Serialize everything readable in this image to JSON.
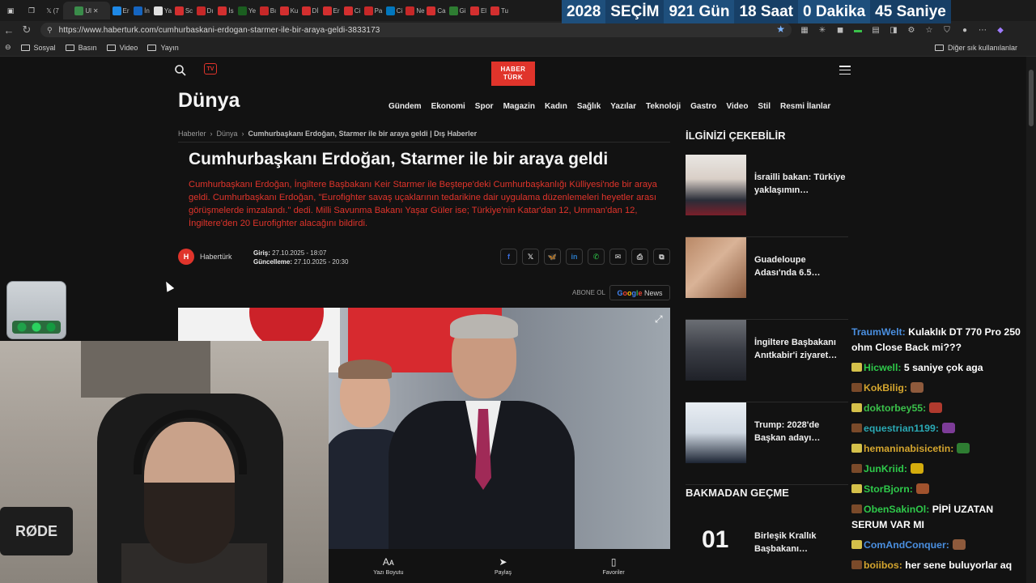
{
  "countdown": {
    "year": "2028",
    "title": "SEÇİM",
    "days": "921",
    "days_unit": "Gün",
    "hours": "18",
    "hours_unit": "Saat",
    "minutes": "0",
    "minutes_unit": "Dakika",
    "seconds": "45",
    "seconds_unit": "Saniye"
  },
  "browser": {
    "url": "https://www.haberturk.com/cumhurbaskani-erdogan-starmer-ile-bir-araya-geldi-3833173",
    "tabs": [
      "(7",
      "Ul",
      "Er",
      "İn",
      "Ya",
      "Sc",
      "Dı",
      "İs",
      "Ye",
      "Bı",
      "Ku",
      "Dİ",
      "Er",
      "Ci",
      "Pa",
      "Ci",
      "Ne",
      "Ca",
      "Gi",
      "El",
      "Tu"
    ],
    "bookmarks": [
      "Sosyal",
      "Basın",
      "Video",
      "Yayın"
    ],
    "bookmarks_other": "Diğer sık kullanılanlar"
  },
  "site": {
    "logo_line1": "HABER",
    "logo_line2": "TÜRK",
    "tv_label": "TV",
    "section": "Dünya",
    "nav": [
      "Gündem",
      "Ekonomi",
      "Spor",
      "Magazin",
      "Kadın",
      "Sağlık",
      "Yazılar",
      "Teknoloji",
      "Gastro",
      "Video",
      "Stil",
      "Resmi İlanlar"
    ]
  },
  "article": {
    "breadcrumb": [
      "Haberler",
      "Dünya",
      "Cumhurbaşkanı Erdoğan, Starmer ile bir araya geldi | Dış Haberler"
    ],
    "headline": "Cumhurbaşkanı Erdoğan, Starmer ile bir araya geldi",
    "lead": "Cumhurbaşkanı Erdoğan, İngiltere Başbakanı Keir Starmer ile Beştepe'deki Cumhurbaşkanlığı Külliyesi'nde bir araya geldi. Cumhurbaşkanı Erdoğan, \"Eurofighter savaş uçaklarının tedarikine dair uygulama düzenlemeleri heyetler arası görüşmelerde imzalandı.\" dedi. Milli Savunma Bakanı Yaşar Güler ise; Türkiye'nin Katar'dan 12, Umman'dan 12, İngiltere'den 20 Eurofighter alacağını bildirdi.",
    "author": "Habertürk",
    "published_label": "Giriş:",
    "published": "27.10.2025 - 18:07",
    "updated_label": "Güncelleme:",
    "updated": "27.10.2025 - 20:30",
    "subscribe": "ABONE OL",
    "gnews_google": "Google",
    "gnews_news": "News",
    "bottom_actions": [
      "Yazı Boyutu",
      "Paylaş",
      "Favoriler"
    ]
  },
  "sidebar": {
    "heading1": "İLGİNİZİ ÇEKEBİLİR",
    "items": [
      "İsrailli bakan: Türkiye yaklaşımın…",
      "Guadeloupe Adası'nda 6.5…",
      "İngiltere Başbakanı Anıtkabir'i ziyaret…",
      "Trump: 2028'de Başkan adayı…"
    ],
    "heading2": "BAKMADAN GEÇME",
    "rank_num": "01",
    "rank_text": "Birleşik Krallık Başbakanı…"
  },
  "stream": {
    "mic_brand": "RØDE",
    "chat": [
      {
        "user": "TraumWelt:",
        "msg": "Kulaklık DT 770 Pro 250 ohm Close Back mi???",
        "color": "#4a8fe0"
      },
      {
        "user": "Hicwell:",
        "msg": "5 saniye çok aga",
        "color": "#2ec94a"
      },
      {
        "user": "KokBilig:",
        "msg": "",
        "color": "#d4a52e"
      },
      {
        "user": "doktorbey55:",
        "msg": "",
        "color": "#3ac04a"
      },
      {
        "user": "equestrian1199:",
        "msg": "",
        "color": "#2aa8b3"
      },
      {
        "user": "hemaninabisicetin:",
        "msg": "",
        "color": "#d4a52e"
      },
      {
        "user": "JunKriid:",
        "msg": "",
        "color": "#2ec94a"
      },
      {
        "user": "StorBjorn:",
        "msg": "",
        "color": "#2ec94a"
      },
      {
        "user": "ObenSakinOl:",
        "msg": "PİPİ UZATAN SERUM VAR MI",
        "color": "#2ec94a"
      },
      {
        "user": "ComAndConquer:",
        "msg": "",
        "color": "#4a8fe0"
      },
      {
        "user": "boiibos:",
        "msg": "her sene buluyorlar aq",
        "color": "#d4a52e"
      }
    ]
  }
}
